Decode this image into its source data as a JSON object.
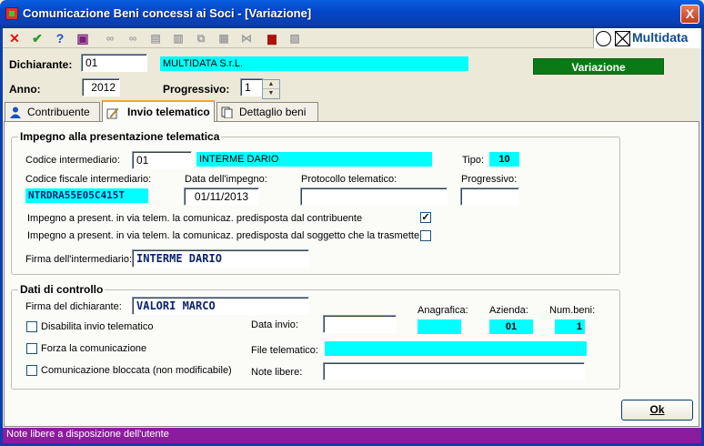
{
  "window": {
    "title": "Comunicazione Beni concessi ai Soci - [Variazione]",
    "close_label": "X"
  },
  "brand": {
    "name": "Multidata"
  },
  "toolbar": {
    "icons": [
      "close-icon",
      "check-icon",
      "help-icon",
      "book-icon",
      "binoculars-icon",
      "binoculars-next-icon",
      "copy-icon",
      "paste-icon",
      "duplicate-icon",
      "print-icon",
      "link-icon",
      "stop-icon",
      "image-icon"
    ]
  },
  "header": {
    "dichiarante_label": "Dichiarante:",
    "dichiarante_code": "01",
    "dichiarante_name": "MULTIDATA S.r.L.",
    "status_badge": "Variazione",
    "anno_label": "Anno:",
    "anno_value": "2012",
    "progressivo_label": "Progressivo:",
    "progressivo_value": "1"
  },
  "tabs": [
    {
      "label": "Contribuente"
    },
    {
      "label": "Invio telematico"
    },
    {
      "label": "Dettaglio beni"
    }
  ],
  "impegno": {
    "title": "Impegno alla presentazione telematica",
    "codice_intermediario_label": "Codice intermediario:",
    "codice_intermediario_value": "01",
    "intermediario_name": "INTERME DARIO",
    "tipo_label": "Tipo:",
    "tipo_value": "10",
    "codice_fiscale_label": "Codice fiscale intermediario:",
    "codice_fiscale_value": "NTRDRA55E05C415T",
    "data_impegno_label": "Data dell'impegno:",
    "data_impegno_value": "01/11/2013",
    "protocollo_label": "Protocollo telematico:",
    "protocollo_value": "",
    "progressivo_label": "Progressivo:",
    "progressivo_value": "",
    "check1_label": "Impegno a present. in via telem. la comunicaz. predisposta dal contribuente",
    "check1_checked": true,
    "check2_label": "Impegno a present. in via telem. la comunicaz. predisposta dal soggetto che la trasmette",
    "check2_checked": false,
    "firma_label": "Firma dell'intermediario:",
    "firma_value": "INTERME DARIO"
  },
  "controllo": {
    "title": "Dati di controllo",
    "firma_label": "Firma del dichiarante:",
    "firma_value": "VALORI MARCO",
    "anagrafica_label": "Anagrafica:",
    "anagrafica_value": "",
    "azienda_label": "Azienda:",
    "azienda_value": "01",
    "numbeni_label": "Num.beni:",
    "numbeni_value": "1",
    "disabilita_label": "Disabilita invio telematico",
    "forza_label": "Forza la comunicazione",
    "bloccata_label": "Comunicazione bloccata (non modificabile)",
    "data_invio_label": "Data invio:",
    "data_invio_value": "",
    "file_label": "File telematico:",
    "file_value": "",
    "note_label": "Note libere:",
    "note_value": ""
  },
  "buttons": {
    "ok_label": "Ok"
  },
  "statusbar": {
    "text": "Note libere a disposizione dell'utente"
  }
}
